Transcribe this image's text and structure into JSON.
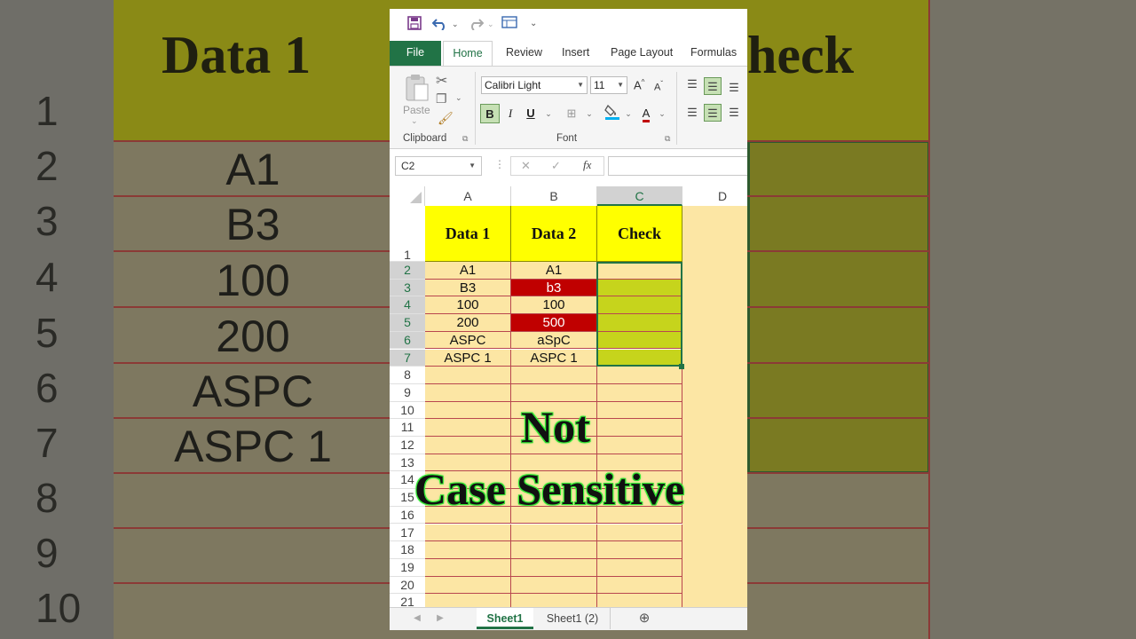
{
  "background": {
    "header_texts": [
      "Data 1",
      "heck"
    ],
    "row_numbers": [
      "1",
      "2",
      "3",
      "4",
      "5",
      "6",
      "7",
      "8",
      "9",
      "10"
    ],
    "col_a_values": [
      "A1",
      "B3",
      "100",
      "200",
      "ASPC",
      "ASPC 1"
    ]
  },
  "quick_access": {
    "save_icon": "save-icon",
    "undo_icon": "undo-icon",
    "redo_icon": "redo-icon",
    "form_icon": "form-icon"
  },
  "tabs": [
    "File",
    "Home",
    "Review",
    "Insert",
    "Page Layout",
    "Formulas"
  ],
  "ribbon": {
    "clipboard": {
      "paste_label": "Paste",
      "group_label": "Clipboard"
    },
    "font": {
      "font_name": "Calibri Light",
      "font_size": "11",
      "bold": "B",
      "italic": "I",
      "underline": "U",
      "font_color": "A",
      "grow": "A",
      "shrink": "A",
      "group_label": "Font"
    }
  },
  "formula_bar": {
    "name_box": "C2",
    "cancel": "✕",
    "enter": "✓",
    "fx": "fx",
    "value": ""
  },
  "grid": {
    "columns": [
      "A",
      "B",
      "C",
      "D"
    ],
    "selected_column": "C",
    "rows": [
      "1",
      "2",
      "3",
      "4",
      "5",
      "6",
      "7",
      "8",
      "9",
      "10",
      "11",
      "12",
      "13",
      "14",
      "15",
      "16",
      "17",
      "18",
      "19",
      "20",
      "21"
    ],
    "headers": [
      "Data 1",
      "Data 2",
      "Check"
    ],
    "data": [
      [
        "A1",
        "A1"
      ],
      [
        "B3",
        "b3"
      ],
      [
        "100",
        "100"
      ],
      [
        "200",
        "500"
      ],
      [
        "ASPC",
        "aSpC"
      ],
      [
        "ASPC 1",
        "ASPC 1"
      ]
    ],
    "highlight_color": "#c00000",
    "cell_bg": "#fce6a4",
    "check_fill": "#c6d41c"
  },
  "caption": {
    "line1": "Not",
    "line2": "Case Sensitive"
  },
  "sheets": [
    "Sheet1",
    "Sheet1 (2)"
  ],
  "active_sheet": "Sheet1"
}
